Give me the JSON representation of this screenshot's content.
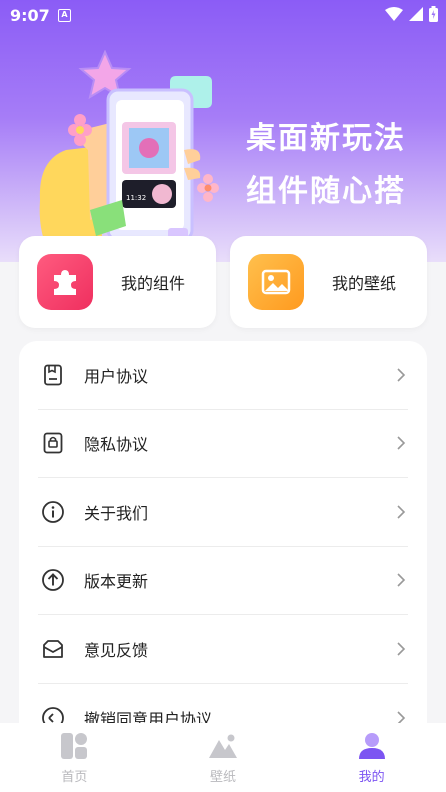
{
  "status": {
    "time": "9:07",
    "notif_badge": "A"
  },
  "hero": {
    "line1": "桌面新玩法",
    "line2": "组件随心搭",
    "phone_time": "11:32"
  },
  "quick": [
    {
      "label": "我的组件",
      "icon": "puzzle-icon",
      "color": "#f5436f"
    },
    {
      "label": "我的壁纸",
      "icon": "picture-icon",
      "color": "#ffa629"
    }
  ],
  "menu": [
    {
      "label": "用户协议",
      "icon": "document-icon"
    },
    {
      "label": "隐私协议",
      "icon": "lock-document-icon"
    },
    {
      "label": "关于我们",
      "icon": "info-icon"
    },
    {
      "label": "版本更新",
      "icon": "upload-icon"
    },
    {
      "label": "意见反馈",
      "icon": "mail-icon"
    },
    {
      "label": "撤销同意用户协议",
      "icon": "revoke-icon"
    }
  ],
  "tabs": [
    {
      "label": "首页",
      "icon": "home-grid-icon"
    },
    {
      "label": "壁纸",
      "icon": "mountain-icon"
    },
    {
      "label": "我的",
      "icon": "user-icon",
      "active": true
    }
  ],
  "colors": {
    "accent": "#7c54f2",
    "hero_top": "#8b5cf6"
  }
}
